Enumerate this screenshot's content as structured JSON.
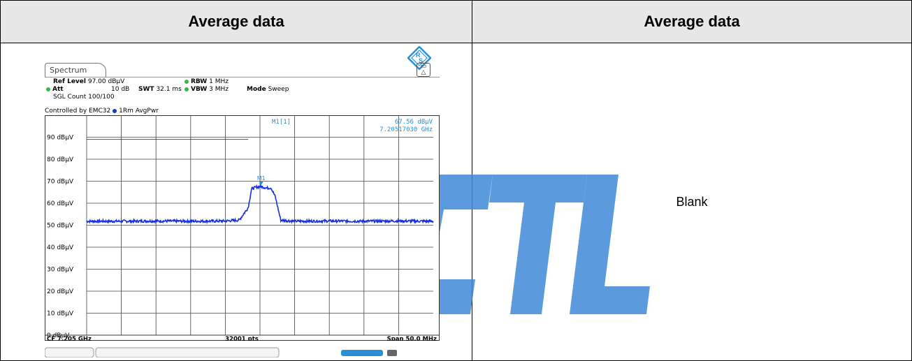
{
  "table": {
    "left_header": "Average data",
    "right_header": "Average data",
    "right_body": "Blank"
  },
  "watermark": {
    "text": "KCTL",
    "color": "#3f88d8"
  },
  "analyzer": {
    "tab_label": "Spectrum",
    "ref_level_label": "Ref Level",
    "ref_level_value": "97.00 dBµV",
    "att_label": "Att",
    "att_value": "10 dB",
    "swt_label": "SWT",
    "swt_value": "32.1 ms",
    "rbw_label": "RBW",
    "rbw_value": "1 MHz",
    "vbw_label": "VBW",
    "vbw_value": "3 MHz",
    "mode_label": "Mode",
    "mode_value": "Sweep",
    "sgl_count": "SGL Count 100/100",
    "controlled_by": "Controlled by EMC32",
    "trace_label": "1Rm AvgPwr",
    "cf_label": "CF 7.205 GHz",
    "pts_label": "32001 pts",
    "span_label": "Span 50.0 MHz",
    "trace_color": "#1530e0",
    "marker_color": "#2b8fd6"
  },
  "chart_data": {
    "type": "line",
    "title": "",
    "xlabel": "",
    "ylabel": "",
    "x_range_mhz": [
      7180,
      7230
    ],
    "ylim": [
      0,
      100
    ],
    "y_tick_labels": [
      "90 dBµV",
      "80 dBµV",
      "70 dBµV",
      "60 dBµV",
      "50 dBµV",
      "40 dBµV",
      "30 dBµV",
      "20 dBµV",
      "10 dBµV",
      "0 dBµV"
    ],
    "y_tick_values": [
      90,
      80,
      70,
      60,
      50,
      40,
      30,
      20,
      10,
      0
    ],
    "grid": true,
    "x_divisions": 10,
    "series": [
      {
        "x": [
          7180,
          7185,
          7190,
          7195,
          7200,
          7202,
          7203.3,
          7203.8,
          7204.5,
          7205.2,
          7206,
          7206.6,
          7207.2,
          7208,
          7210,
          7215,
          7220,
          7225,
          7230
        ],
        "values": [
          51.8,
          51.8,
          51.9,
          51.8,
          51.9,
          52.3,
          58,
          66.6,
          67.3,
          67.56,
          66.9,
          67.0,
          63,
          52.3,
          51.8,
          51.9,
          51.8,
          51.9,
          51.8
        ]
      }
    ],
    "markers": [
      {
        "label": "M1",
        "readout_label": "M1[1]",
        "x_mhz": 7205.1703,
        "y": 67.56,
        "readout_value": "67.56 dBµV",
        "readout_freq": "7.20517030 GHz"
      }
    ],
    "reference_line": {
      "y": 89
    }
  }
}
